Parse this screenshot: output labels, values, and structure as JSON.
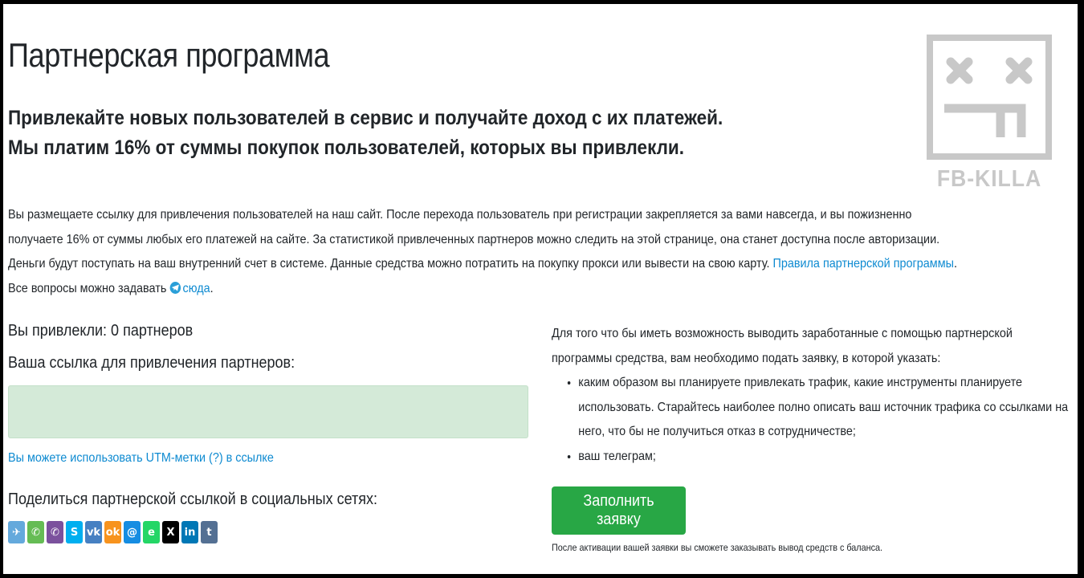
{
  "header": {
    "title": "Партнерская программа",
    "lead_line1": "Привлекайте новых пользователей в сервис и получайте доход с их платежей.",
    "lead_line2": "Мы платим 16% от суммы покупок пользователей, которых вы привлекли."
  },
  "logo": {
    "text": "FB-KILLA",
    "color": "#c8c8c8"
  },
  "description": {
    "text_before_link": "Вы размещаете ссылку для привлечения пользователей на наш сайт. После перехода пользователь при регистрации закрепляется за вами навсегда, и вы пожизненно получаете 16% от суммы любых его платежей на сайте. За статистикой привлеченных партнеров можно следить на этой странице, она станет доступна после авторизации. Деньги будут поступать на ваш внутренний счет в системе. Данные средства можно потратить на покупку прокси или вывести на свою карту. ",
    "rules_link": "Правила партнерской программы",
    "text_after_link": ". Все вопросы можно задавать ",
    "contact_icon": "telegram-icon",
    "contact_link": "сюда",
    "end": "."
  },
  "referral": {
    "stat": "Вы привлекли: 0 партнеров",
    "link_label": "Ваша ссылка для привлечения партнеров:",
    "link_value": "",
    "utm_hint": "Вы можете использовать UTM-метки (?) в ссылке",
    "share_label": "Поделиться партнерской ссылкой в социальных сетях:"
  },
  "social": [
    {
      "name": "telegram",
      "icon": "telegram-icon",
      "glyph": "✈",
      "color": "#64a9dc"
    },
    {
      "name": "whatsapp",
      "icon": "whatsapp-icon",
      "glyph": "✆",
      "color": "#65bc54"
    },
    {
      "name": "viber",
      "icon": "viber-icon",
      "glyph": "✆",
      "color": "#7b519d"
    },
    {
      "name": "skype",
      "icon": "skype-icon",
      "glyph": "S",
      "color": "#00aff0"
    },
    {
      "name": "vk",
      "icon": "vk-icon",
      "glyph": "vk",
      "color": "#4680c2"
    },
    {
      "name": "odnoklassniki",
      "icon": "odnoklassniki-icon",
      "glyph": "ok",
      "color": "#f7931e"
    },
    {
      "name": "moimir",
      "icon": "moimir-icon",
      "glyph": "@",
      "color": "#168de2"
    },
    {
      "name": "evernote",
      "icon": "evernote-icon",
      "glyph": "e",
      "color": "#24d666"
    },
    {
      "name": "x",
      "icon": "x-icon",
      "glyph": "X",
      "color": "#000000"
    },
    {
      "name": "linkedin",
      "icon": "linkedin-icon",
      "glyph": "in",
      "color": "#0077b5"
    },
    {
      "name": "tumblr",
      "icon": "tumblr-icon",
      "glyph": "t",
      "color": "#547093"
    }
  ],
  "apply": {
    "intro": "Для того что бы иметь возможность выводить заработанные с помощью партнерской программы средства, вам необходимо подать заявку, в которой указать:",
    "requirements": [
      "каким образом вы планируете привлекать трафик, какие инструменты планируете использовать. Старайтесь наиболее полно описать ваш источник трафика со ссылками на него, что бы не получиться отказ в сотрудничестве;",
      "ваш телеграм;"
    ],
    "button_label": "Заполнить заявку",
    "note": "После активации вашей заявки вы сможете заказывать вывод средств с баланса."
  }
}
